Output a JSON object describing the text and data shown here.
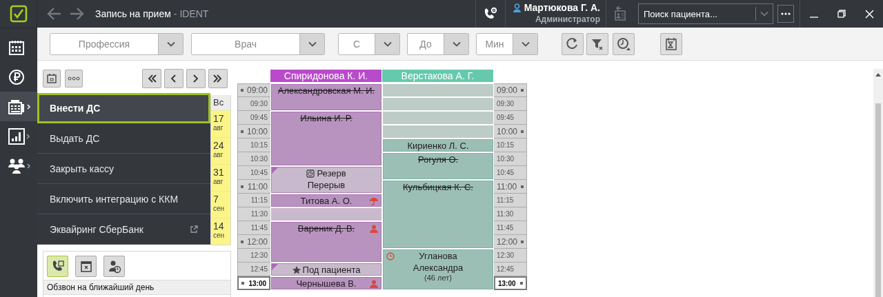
{
  "window": {
    "title": "Запись на прием",
    "app_name": "- IDENT"
  },
  "user": {
    "name": "Мартюкова Г. А.",
    "role": "Администратор"
  },
  "patient_search": {
    "placeholder": "Поиск пациента..."
  },
  "filters": [
    {
      "placeholder": "Профессия"
    },
    {
      "placeholder": "Врач"
    },
    {
      "placeholder": "С"
    },
    {
      "placeholder": "До"
    },
    {
      "placeholder": "Мин"
    }
  ],
  "sidebar": {
    "items": [
      {
        "kind": "calendar",
        "selected": false,
        "submenu": false
      },
      {
        "kind": "ruble",
        "selected": false,
        "submenu": false
      },
      {
        "kind": "register",
        "selected": true,
        "submenu": true
      },
      {
        "kind": "chart",
        "selected": false,
        "submenu": true
      },
      {
        "kind": "people",
        "selected": false,
        "submenu": true
      }
    ]
  },
  "cash_menu": {
    "items": [
      {
        "label": "Внести ДС",
        "selected": true,
        "external": false
      },
      {
        "label": "Выдать ДС",
        "selected": false,
        "external": false
      },
      {
        "label": "Закрыть кассу",
        "selected": false,
        "external": false
      },
      {
        "label": "Включить интеграцию с ККМ",
        "selected": false,
        "external": false
      },
      {
        "label": "Эквайринг СберБанк",
        "selected": false,
        "external": true
      }
    ]
  },
  "mini_calendar": {
    "day_header": "Вс",
    "dates": [
      {
        "day": "17",
        "month": "авг"
      },
      {
        "day": "24",
        "month": "авг"
      },
      {
        "day": "31",
        "month": "авг"
      },
      {
        "day": "7",
        "month": "сен"
      },
      {
        "day": "14",
        "month": "сен"
      }
    ]
  },
  "call_panel": {
    "tabs": [
      {
        "kind": "calls",
        "selected": true
      },
      {
        "kind": "cancelled",
        "selected": false
      },
      {
        "kind": "patients",
        "selected": false
      }
    ],
    "heading": "Обзвон на ближайший день"
  },
  "schedule": {
    "doctors": [
      {
        "name": "Спиридонова К. И.",
        "color": "#b94bcb"
      },
      {
        "name": "Верстакова А. Г.",
        "color": "#66c9ad"
      }
    ],
    "times": [
      {
        "left": "09:00",
        "right": "09:00",
        "major": true,
        "current": false
      },
      {
        "left": "09:30",
        "right": "09:30",
        "major": false,
        "current": false
      },
      {
        "left": "09:45",
        "right": "09:45",
        "major": false,
        "current": false
      },
      {
        "left": "10:00",
        "right": "10:00",
        "major": true,
        "current": false
      },
      {
        "left": "10:15",
        "right": "10:15",
        "major": false,
        "current": false
      },
      {
        "left": "10:30",
        "right": "10:30",
        "major": false,
        "current": false
      },
      {
        "left": "10:45",
        "right": "10:45",
        "major": false,
        "current": false
      },
      {
        "left": "11:00",
        "right": "11:00",
        "major": true,
        "current": false
      },
      {
        "left": "11:15",
        "right": "11:15",
        "major": false,
        "current": false
      },
      {
        "left": "11:30",
        "right": "11:30",
        "major": false,
        "current": false
      },
      {
        "left": "11:45",
        "right": "11:45",
        "major": false,
        "current": false
      },
      {
        "left": "12:00",
        "right": "12:00",
        "major": true,
        "current": false
      },
      {
        "left": "12:30",
        "right": "12:30",
        "major": false,
        "current": false
      },
      {
        "left": "12:45",
        "right": "12:45",
        "major": false,
        "current": false
      },
      {
        "left": "13:00",
        "right": "13:00",
        "major": true,
        "current": true
      }
    ],
    "columns": [
      [
        {
          "kind": "appointment",
          "lines": [
            "Александровская М. И."
          ],
          "cancelled": true
        },
        {
          "kind": "continued"
        },
        {
          "kind": "appointment",
          "lines": [
            "Ильина И. Р."
          ],
          "cancelled": true
        },
        {
          "kind": "continued"
        },
        {
          "kind": "continued"
        },
        {
          "kind": "continued"
        },
        {
          "kind": "reserve",
          "lines": [
            "Резерв",
            "Перерыв"
          ]
        },
        {
          "kind": "continued"
        },
        {
          "kind": "appointment",
          "lines": [
            "Титова А. О."
          ],
          "cancelled": false
        },
        {
          "kind": "free"
        },
        {
          "kind": "appointment",
          "lines": [
            "Вареник Д. В."
          ],
          "cancelled": true
        },
        {
          "kind": "continued"
        },
        {
          "kind": "continued"
        },
        {
          "kind": "reserve",
          "lines": [
            "Под пациента"
          ]
        },
        {
          "kind": "appointment",
          "lines": [
            "Чернышева В."
          ],
          "cancelled": false
        }
      ],
      [
        {
          "kind": "free"
        },
        {
          "kind": "free"
        },
        {
          "kind": "free"
        },
        {
          "kind": "free"
        },
        {
          "kind": "appointment",
          "lines": [
            "Кириенко Л. С."
          ],
          "cancelled": false
        },
        {
          "kind": "appointment",
          "lines": [
            "Рогуля О."
          ],
          "cancelled": true
        },
        {
          "kind": "continued"
        },
        {
          "kind": "appointment",
          "lines": [
            "Кульбицкая К. С."
          ],
          "cancelled": true
        },
        {
          "kind": "continued"
        },
        {
          "kind": "continued"
        },
        {
          "kind": "continued"
        },
        {
          "kind": "continued"
        },
        {
          "kind": "appointment",
          "lines": [
            "Угланова",
            "Александра",
            "(46 лет)"
          ],
          "cancelled": false
        },
        {
          "kind": "continued"
        },
        {
          "kind": "continued"
        }
      ]
    ]
  }
}
